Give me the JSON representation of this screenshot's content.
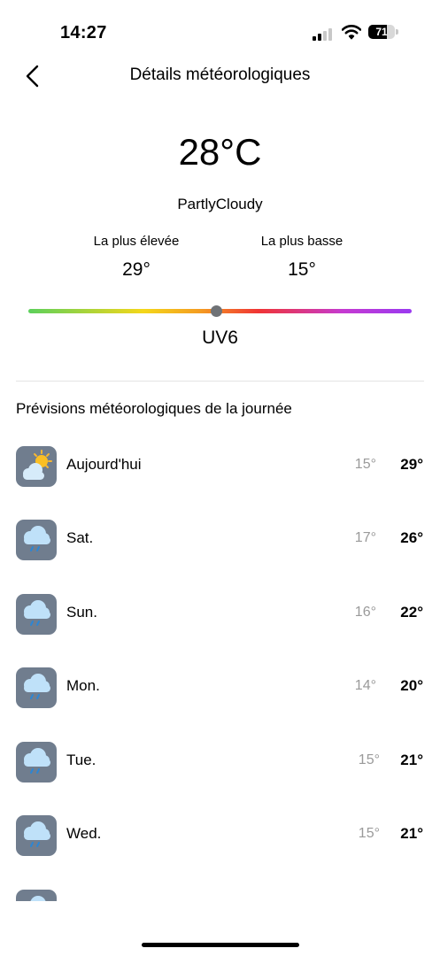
{
  "status_bar": {
    "time": "14:27",
    "battery": "71",
    "battery_level": 0.71
  },
  "nav": {
    "title": "Détails météorologiques",
    "back_icon": "chevron-left-icon"
  },
  "current": {
    "temperature": "28°C",
    "condition": "PartlyCloudy",
    "high_label": "La plus élevée",
    "high_value": "29°",
    "low_label": "La plus basse",
    "low_value": "15°",
    "uv_label": "UV6",
    "uv_level": 0.49
  },
  "forecast": {
    "section_title": "Prévisions météorologiques de la journée",
    "days": [
      {
        "day": "Aujourd'hui",
        "low": "15°",
        "high": "29°",
        "icon": "partly-cloudy-icon"
      },
      {
        "day": "Sat.",
        "low": "17°",
        "high": "26°",
        "icon": "rain-cloud-icon"
      },
      {
        "day": "Sun.",
        "low": "16°",
        "high": "22°",
        "icon": "rain-cloud-icon"
      },
      {
        "day": "Mon.",
        "low": "14°",
        "high": "20°",
        "icon": "rain-cloud-icon"
      },
      {
        "day": "Tue.",
        "low": "15°",
        "high": "21°",
        "icon": "rain-cloud-icon"
      },
      {
        "day": "Wed.",
        "low": "15°",
        "high": "21°",
        "icon": "rain-cloud-icon"
      },
      {
        "day": "",
        "low": "",
        "high": "",
        "icon": "rain-cloud-icon"
      }
    ]
  },
  "colors": {
    "icon_background": "#707d8e",
    "divider": "#e3e3e3",
    "uv_knob": "#6f7276"
  }
}
